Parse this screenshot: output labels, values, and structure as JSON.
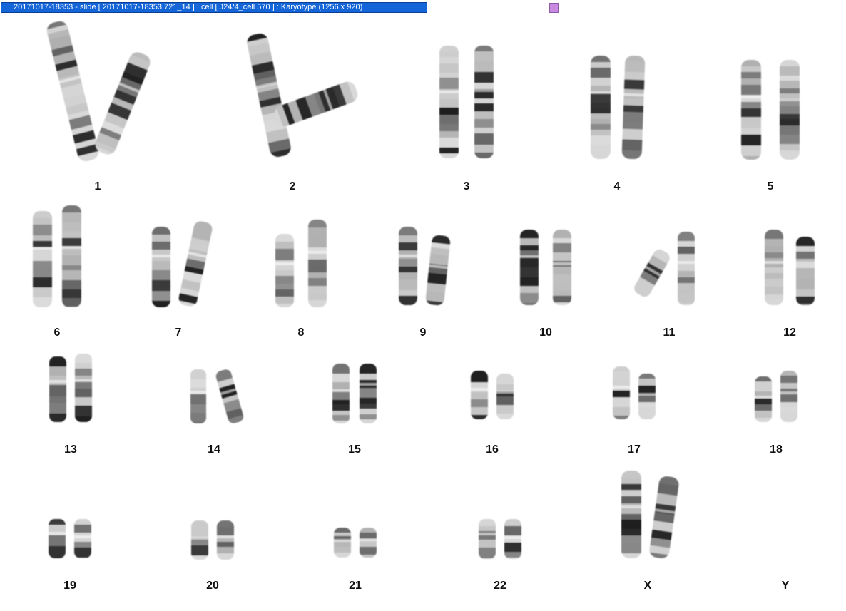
{
  "window": {
    "title": "20171017-18353 - slide [ 20171017-18353 721_14 ] : cell [ J24/4_cell 570 ] : Karyotype  (1256 x 920)"
  },
  "colors": {
    "title_bar": "#1465d8",
    "scroll_thumb": "#c78be0",
    "chromosome_light": "#d7d7d7",
    "chromosome_dark": "#262626"
  },
  "chromosomes": [
    {
      "label": "1"
    },
    {
      "label": "2"
    },
    {
      "label": "3"
    },
    {
      "label": "4"
    },
    {
      "label": "5"
    },
    {
      "label": "6"
    },
    {
      "label": "7"
    },
    {
      "label": "8"
    },
    {
      "label": "9"
    },
    {
      "label": "10"
    },
    {
      "label": "11"
    },
    {
      "label": "12"
    },
    {
      "label": "13"
    },
    {
      "label": "14"
    },
    {
      "label": "15"
    },
    {
      "label": "16"
    },
    {
      "label": "17"
    },
    {
      "label": "18"
    },
    {
      "label": "19"
    },
    {
      "label": "20"
    },
    {
      "label": "21"
    },
    {
      "label": "22"
    },
    {
      "label": "X"
    },
    {
      "label": "Y"
    }
  ]
}
